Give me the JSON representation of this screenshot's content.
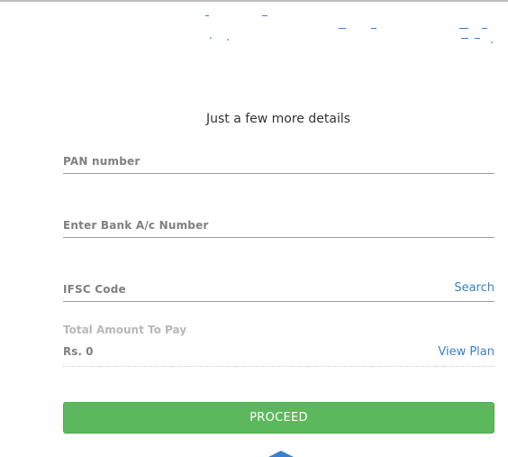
{
  "form": {
    "heading": "Just a few more details",
    "pan_placeholder": "PAN number",
    "bank_placeholder": "Enter Bank A/c Number",
    "ifsc_placeholder": "IFSC Code",
    "search_link": "Search",
    "total_label": "Total Amount To Pay",
    "total_value": "Rs. 0",
    "view_plan_link": "View Plan",
    "proceed_label": "PROCEED"
  },
  "colors": {
    "accent_blue": "#3a80c9",
    "proceed_green": "#5cb85c",
    "label_gray": "#808080",
    "underline_gray": "#9e9e9e"
  }
}
